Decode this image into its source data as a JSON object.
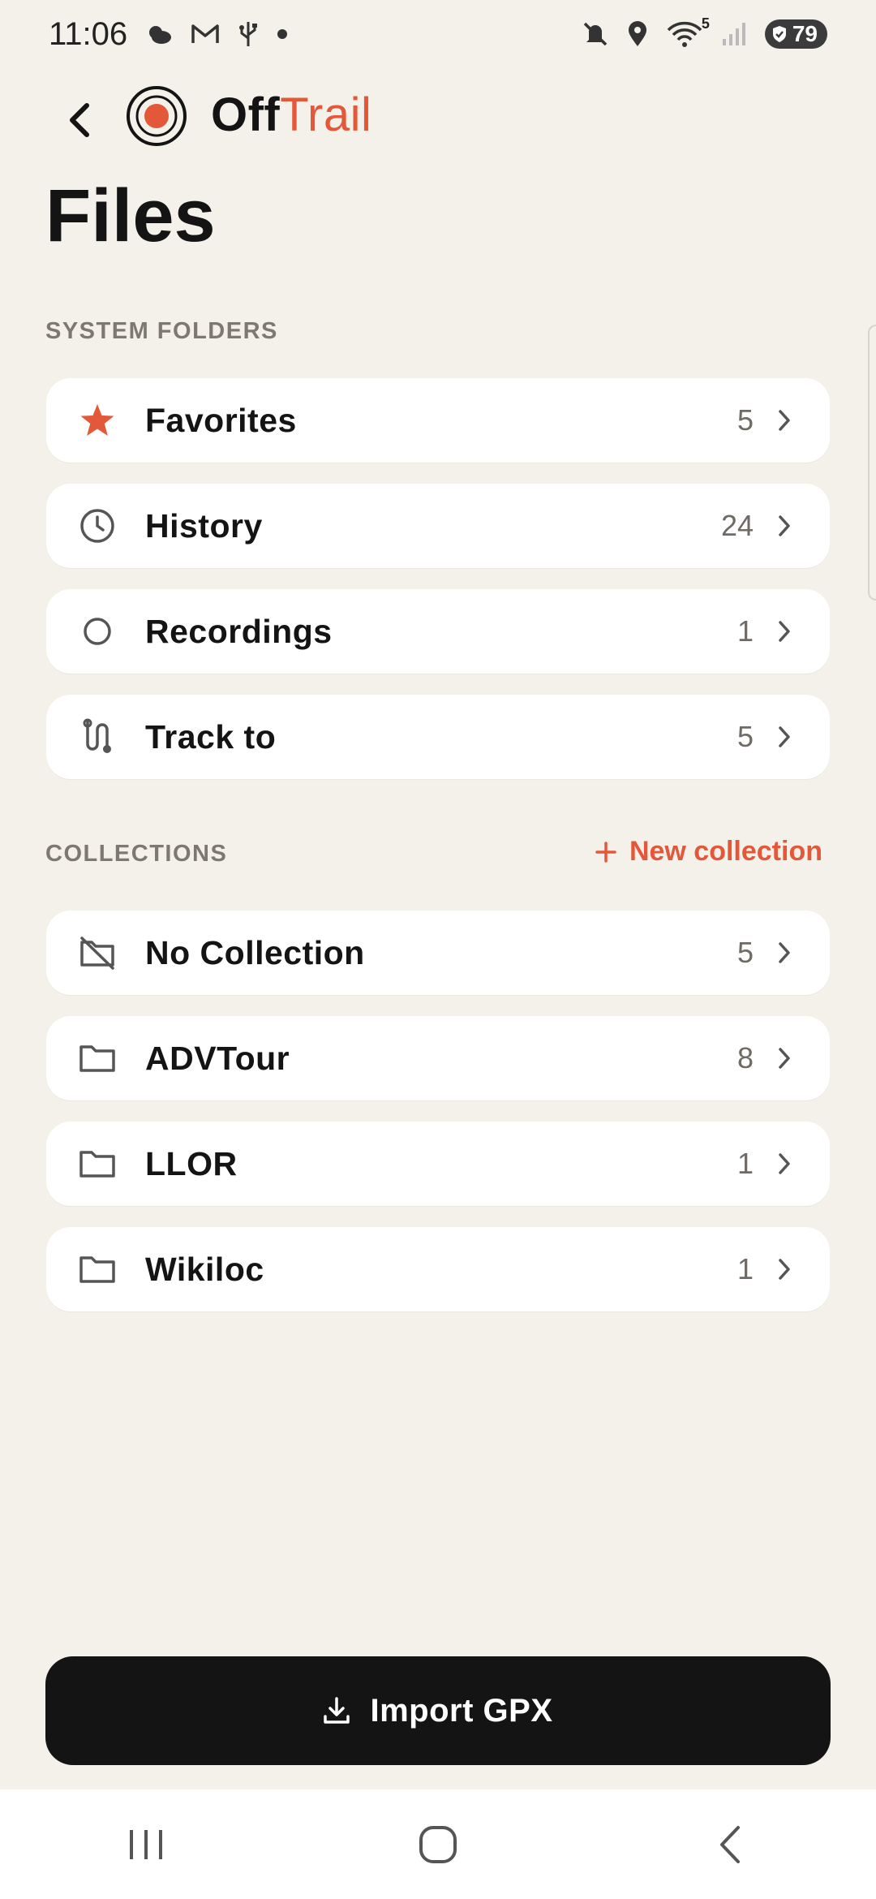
{
  "status_bar": {
    "time": "11:06",
    "wifi_label": "5",
    "battery": "79",
    "left_icons": [
      "weather-icon",
      "gmail-icon",
      "usb-icon",
      "dot-icon"
    ],
    "right_icons": [
      "mute-icon",
      "location-icon",
      "wifi-icon",
      "signal-icon",
      "battery-icon"
    ]
  },
  "header": {
    "brand_part1": "Off",
    "brand_part2": "Trail",
    "brand_color": "#e4583a"
  },
  "page": {
    "title": "Files"
  },
  "system_folders": {
    "label": "SYSTEM FOLDERS",
    "items": [
      {
        "label": "Favorites",
        "count": "5",
        "icon": "star-icon"
      },
      {
        "label": "History",
        "count": "24",
        "icon": "clock-icon"
      },
      {
        "label": "Recordings",
        "count": "1",
        "icon": "circle-icon"
      },
      {
        "label": "Track to",
        "count": "5",
        "icon": "route-icon"
      }
    ]
  },
  "collections": {
    "label": "COLLECTIONS",
    "new_label": "New collection",
    "items": [
      {
        "label": "No Collection",
        "count": "5",
        "icon": "folder-off-icon"
      },
      {
        "label": "ADVTour",
        "count": "8",
        "icon": "folder-icon"
      },
      {
        "label": "LLOR",
        "count": "1",
        "icon": "folder-icon"
      },
      {
        "label": "Wikiloc",
        "count": "1",
        "icon": "folder-icon"
      }
    ]
  },
  "import": {
    "label": "Import GPX",
    "icon": "download-icon"
  },
  "nav_bar": {
    "icons": [
      "recents-icon",
      "home-icon",
      "back-icon"
    ]
  },
  "colors": {
    "background": "#f4f1ea",
    "accent": "#e4583a",
    "card": "#ffffff",
    "button": "#141414"
  }
}
